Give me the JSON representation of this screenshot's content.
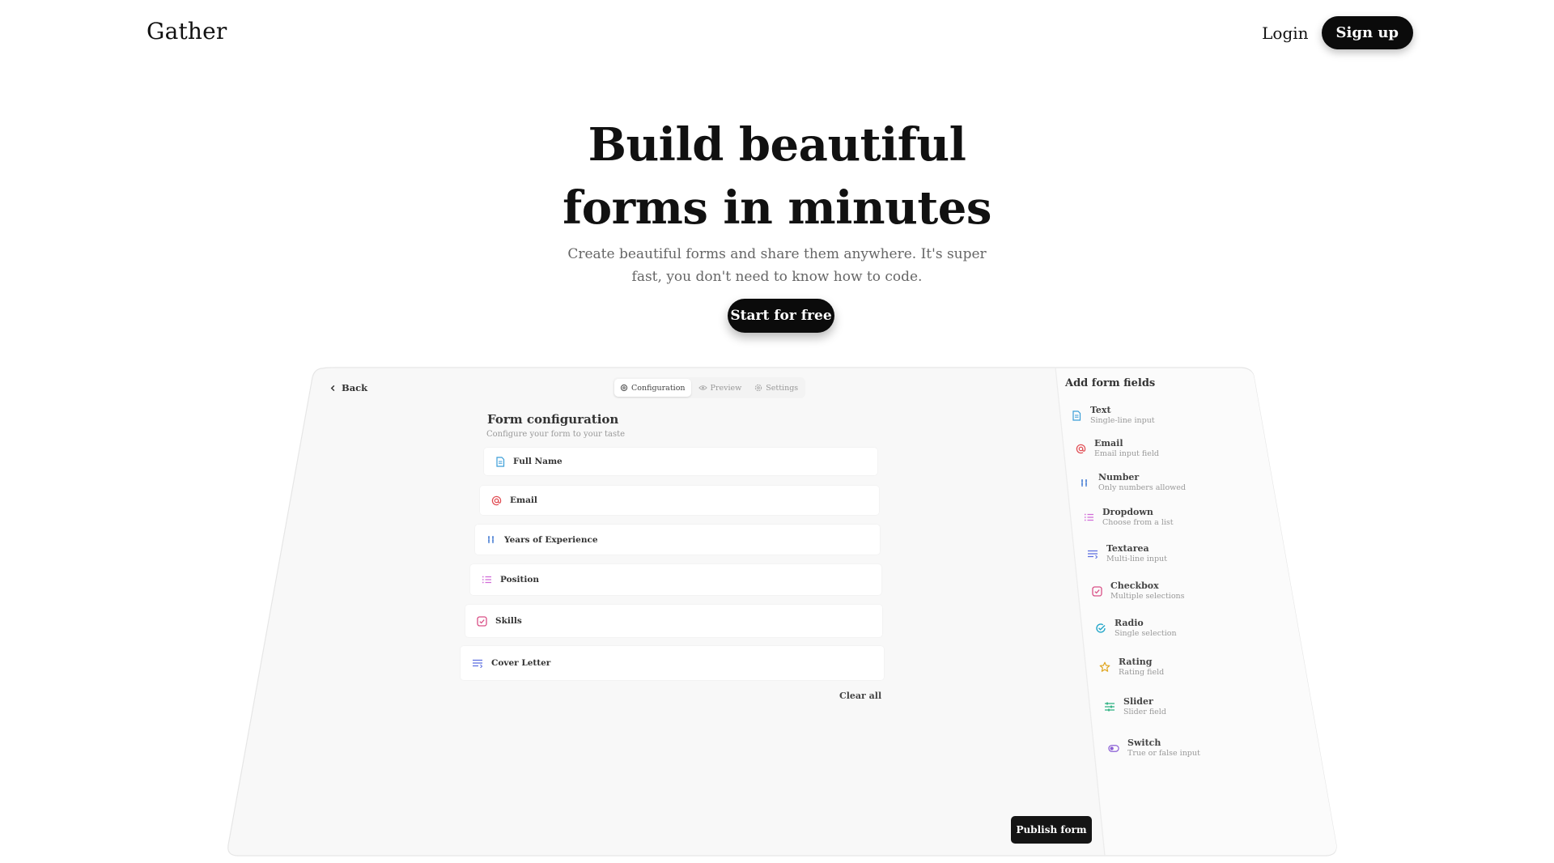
{
  "nav": {
    "logo": "Gather",
    "login_label": "Login",
    "signup_label": "Sign up"
  },
  "hero": {
    "title_line1": "Build beautiful",
    "title_line2": "forms in minutes",
    "subtitle_line1": "Create beautiful forms and share them anywhere. It's super",
    "subtitle_line2": "fast, you don't need to know how to code.",
    "cta_label": "Start for free"
  },
  "app": {
    "back_label": "Back",
    "tabs": [
      {
        "label": "Configuration",
        "icon": "gear-icon",
        "active": true
      },
      {
        "label": "Preview",
        "icon": "eye-icon",
        "active": false
      },
      {
        "label": "Settings",
        "icon": "settings-icon",
        "active": false
      }
    ],
    "form_config": {
      "title": "Form configuration",
      "subtitle": "Configure your form to your taste"
    },
    "fields": [
      {
        "label": "Full Name",
        "icon": "text-icon",
        "color": "#3b9ed8"
      },
      {
        "label": "Email",
        "icon": "at-icon",
        "color": "#e0484f"
      },
      {
        "label": "Years of Experience",
        "icon": "number-icon",
        "color": "#4a7fd4"
      },
      {
        "label": "Position",
        "icon": "list-icon",
        "color": "#d16bd8"
      },
      {
        "label": "Skills",
        "icon": "checkbox-icon",
        "color": "#d94f86"
      },
      {
        "label": "Cover Letter",
        "icon": "textarea-icon",
        "color": "#5b6ee0"
      }
    ],
    "clear_all_label": "Clear all",
    "publish_label": "Publish form",
    "add_fields": {
      "title": "Add form fields",
      "items": [
        {
          "label": "Text",
          "desc": "Single-line input",
          "icon": "text-icon",
          "color": "#3b9ed8"
        },
        {
          "label": "Email",
          "desc": "Email input field",
          "icon": "at-icon",
          "color": "#e0484f"
        },
        {
          "label": "Number",
          "desc": "Only numbers allowed",
          "icon": "number-icon",
          "color": "#4a7fd4"
        },
        {
          "label": "Dropdown",
          "desc": "Choose from a list",
          "icon": "list-icon",
          "color": "#d16bd8"
        },
        {
          "label": "Textarea",
          "desc": "Multi-line input",
          "icon": "textarea-icon",
          "color": "#5b6ee0"
        },
        {
          "label": "Checkbox",
          "desc": "Multiple selections",
          "icon": "checkbox-icon",
          "color": "#d94f86"
        },
        {
          "label": "Radio",
          "desc": "Single selection",
          "icon": "radio-icon",
          "color": "#22a6c9"
        },
        {
          "label": "Rating",
          "desc": "Rating field",
          "icon": "star-icon",
          "color": "#e0a51e"
        },
        {
          "label": "Slider",
          "desc": "Slider field",
          "icon": "slider-icon",
          "color": "#2ab07f"
        },
        {
          "label": "Switch",
          "desc": "True or false input",
          "icon": "switch-icon",
          "color": "#8b5fd6"
        }
      ]
    }
  }
}
